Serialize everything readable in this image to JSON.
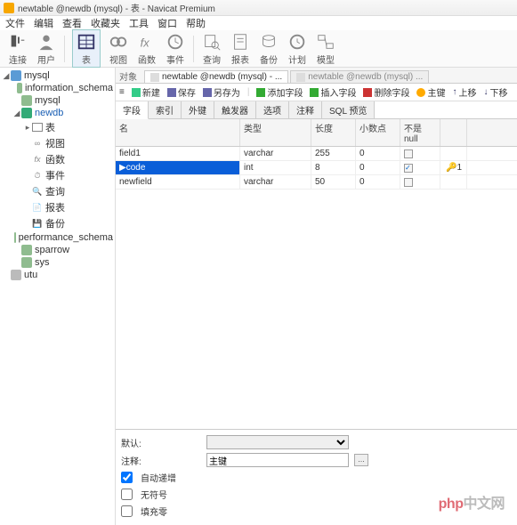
{
  "window": {
    "title": "newtable @newdb (mysql) - 表 - Navicat Premium"
  },
  "menus": [
    "文件",
    "编辑",
    "查看",
    "收藏夹",
    "工具",
    "窗口",
    "帮助"
  ],
  "toolbar1": [
    {
      "label": "连接",
      "svg": "plug"
    },
    {
      "label": "用户",
      "svg": "user"
    },
    {
      "label": "表",
      "svg": "table",
      "active": true
    },
    {
      "label": "视图",
      "svg": "view"
    },
    {
      "label": "函数",
      "svg": "fx"
    },
    {
      "label": "事件",
      "svg": "event"
    },
    {
      "label": "查询",
      "svg": "query"
    },
    {
      "label": "报表",
      "svg": "report"
    },
    {
      "label": "备份",
      "svg": "backup"
    },
    {
      "label": "计划",
      "svg": "clock"
    },
    {
      "label": "模型",
      "svg": "model"
    }
  ],
  "tree": {
    "root": "mysql",
    "schemas": [
      "information_schema",
      "mysql",
      "newdb",
      "performance_schema",
      "sparrow",
      "sys"
    ],
    "open_schema": "newdb",
    "open_items": [
      {
        "label": "表",
        "icon": "tbl"
      },
      {
        "label": "视图",
        "icon": "oo"
      },
      {
        "label": "函数",
        "icon": "fx"
      },
      {
        "label": "事件",
        "icon": "ev"
      },
      {
        "label": "查询",
        "icon": "q"
      },
      {
        "label": "报表",
        "icon": "r"
      },
      {
        "label": "备份",
        "icon": "b"
      }
    ],
    "extra_root": "utu"
  },
  "tabs": {
    "prefix": "对象",
    "items": [
      {
        "label": "newtable @newdb (mysql) - ...",
        "active": true
      },
      {
        "label": "newtable @newdb (mysql) ...",
        "active": false
      }
    ]
  },
  "toolbar2": {
    "new": "新建",
    "save": "保存",
    "saveas": "另存为",
    "addfield": "添加字段",
    "insfield": "插入字段",
    "delfield": "删除字段",
    "pkey": "主键",
    "up": "上移",
    "down": "下移"
  },
  "subtabs": [
    "字段",
    "索引",
    "外键",
    "触发器",
    "选项",
    "注释",
    "SQL 预览"
  ],
  "grid": {
    "headers": [
      "名",
      "类型",
      "长度",
      "小数点",
      "不是 null",
      ""
    ],
    "rows": [
      {
        "name": "field1",
        "type": "varchar",
        "len": "255",
        "dec": "0",
        "nn": false,
        "key": false
      },
      {
        "name": "code",
        "type": "int",
        "len": "8",
        "dec": "0",
        "nn": true,
        "key": true,
        "keylabel": "1",
        "selected": true
      },
      {
        "name": "newfield",
        "type": "varchar",
        "len": "50",
        "dec": "0",
        "nn": false,
        "key": false
      }
    ]
  },
  "bottom": {
    "default_label": "默认:",
    "comment_label": "注释:",
    "comment_value": "主键",
    "auto_inc": "自动递增",
    "unsigned": "无符号",
    "zerofill": "填充零"
  },
  "watermark": {
    "a": "php",
    "b": "中文网"
  }
}
